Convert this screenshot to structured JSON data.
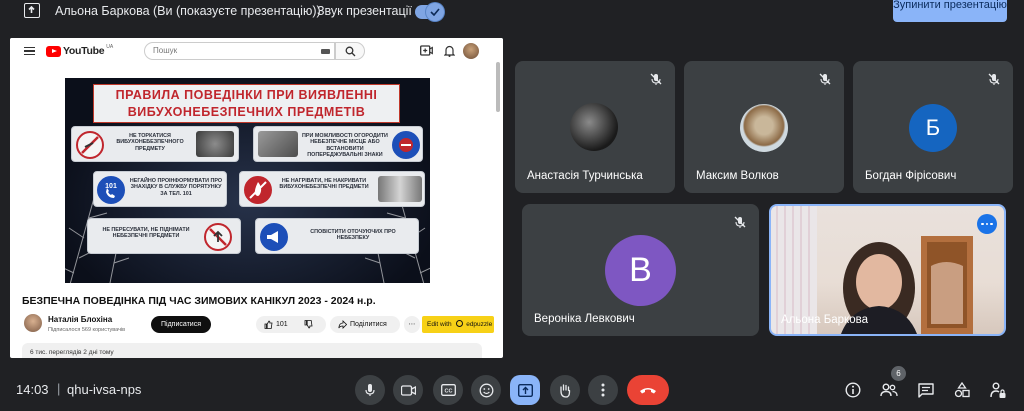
{
  "topbar": {
    "presenting_text": "Альона Баркова (Ви (показуєте презентацію))",
    "sound_label": "Звук презентації",
    "sound_enabled": true,
    "stop_button": "Зупинити презентацію"
  },
  "presentation": {
    "youtube": {
      "logo": "YouTube",
      "region": "UA",
      "search_placeholder": "Пошук"
    },
    "slide": {
      "title_line1": "ПРАВИЛА ПОВЕДІНКИ ПРИ ВИЯВЛЕННІ",
      "title_line2": "ВИБУХОНЕБЕЗПЕЧНИХ ПРЕДМЕТІВ",
      "rules": [
        "НЕ ТОРКАТИСЯ ВИБУХОНЕБЕЗПЕЧНОГО ПРЕДМЕТУ",
        "ПРИ МОЖЛИВОСТІ ОГОРОДИТИ НЕБЕЗПЕЧНЕ МІСЦЕ АБО ВСТАНОВИТИ ПОПЕРЕДЖУВАЛЬНІ ЗНАКИ",
        "НЕГАЙНО ПРОІНФОРМУВАТИ ПРО ЗНАХІДКУ В СЛУЖБУ ПОРЯТУНКУ ЗА ТЕЛ. 101",
        "НЕ НАГРІВАТИ, НЕ НАКРИВАТИ ВИБУХОНЕБЕЗПЕЧНІ ПРЕДМЕТИ",
        "НЕ ПЕРЕСУВАТИ, НЕ ПІДНІМАТИ НЕБЕЗПЕЧНІ ПРЕДМЕТИ",
        "СПОВІСТИТИ ОТОЧУЮЧИХ ПРО НЕБЕЗПЕКУ"
      ],
      "phone_number": "101"
    },
    "video_title": "БЕЗПЕЧНА ПОВЕДІНКА ПІД ЧАС ЗИМОВИХ КАНІКУЛ 2023 - 2024 н.р.",
    "channel_name": "Наталія Блохіна",
    "channel_subs": "Підписалося 569 користувачів",
    "subscribe": "Підписатися",
    "likes": "101",
    "share": "Поділитися",
    "edit_with": "Edit with",
    "edpuzzle": "edpuzzle",
    "description": "6 тис. переглядів  2 дні тому"
  },
  "participants": [
    {
      "name": "Анастасія Турчинська",
      "muted": true,
      "avatar": "photo"
    },
    {
      "name": "Максим Волков",
      "muted": true,
      "avatar": "photo"
    },
    {
      "name": "Богдан Фірісович",
      "muted": true,
      "avatar": "letter",
      "letter": "Б",
      "color": "#1565c0"
    },
    {
      "name": "Вероніка Левкович",
      "muted": true,
      "avatar": "letter",
      "letter": "В",
      "color": "#7e57c2"
    },
    {
      "name": "Альона Баркова",
      "muted": false,
      "avatar": "video"
    }
  ],
  "bottombar": {
    "time": "14:03",
    "separator": "|",
    "meeting_code": "qhu-ivsa-nps",
    "participants_count": "6"
  }
}
